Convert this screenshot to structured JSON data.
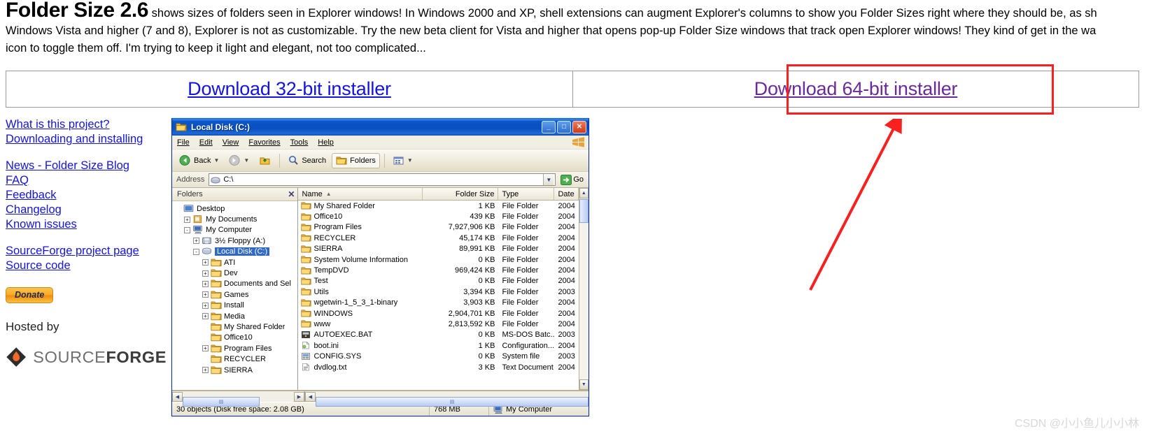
{
  "intro": {
    "title": "Folder Size 2.6",
    "line1_rest": " shows sizes of folders seen in Explorer windows! In Windows 2000 and XP, shell extensions can augment Explorer's columns to show you Folder Sizes right where they should be, as sh",
    "line2": "Windows Vista and higher (7 and 8), Explorer is not as customizable. Try the new beta client for Vista and higher that opens pop-up Folder Size windows that track open Explorer windows! They kind of get in the wa",
    "line3": "icon to toggle them off. I'm trying to keep it light and elegant, not too complicated..."
  },
  "downloads": {
    "x86_label": "Download 32-bit installer",
    "x64_label": "Download 64-bit installer",
    "annotation_color": "#fb2020"
  },
  "sidebar": {
    "group1": [
      {
        "label": "What is this project?"
      },
      {
        "label": "Downloading and installing"
      }
    ],
    "group2": [
      {
        "label": "News - Folder Size Blog"
      },
      {
        "label": "FAQ"
      },
      {
        "label": "Feedback"
      },
      {
        "label": "Changelog"
      },
      {
        "label": "Known issues"
      }
    ],
    "group3": [
      {
        "label": "SourceForge project page"
      },
      {
        "label": "Source code"
      }
    ],
    "donate_label": "Donate",
    "hosted_by": "Hosted by",
    "sf_logo_light": "SOURCE",
    "sf_logo_bold": "FORGE"
  },
  "explorer": {
    "title": "Local Disk (C:)",
    "window_buttons": {
      "minimize": "_",
      "maximize": "□",
      "close": "✕"
    },
    "menu": [
      "File",
      "Edit",
      "View",
      "Favorites",
      "Tools",
      "Help"
    ],
    "toolbar": {
      "back": "Back",
      "search": "Search",
      "folders": "Folders"
    },
    "address": {
      "label": "Address",
      "value": "C:\\",
      "go": "Go"
    },
    "folders_pane": {
      "header": "Folders",
      "close": "✕"
    },
    "tree": [
      {
        "indent": 0,
        "expander": "",
        "icon": "desktop-icon",
        "label": "Desktop",
        "selected": false
      },
      {
        "indent": 1,
        "expander": "+",
        "icon": "documents-icon",
        "label": "My Documents",
        "selected": false
      },
      {
        "indent": 1,
        "expander": "-",
        "icon": "computer-icon",
        "label": "My Computer",
        "selected": false
      },
      {
        "indent": 2,
        "expander": "+",
        "icon": "floppy-icon",
        "label": "3½ Floppy (A:)",
        "selected": false
      },
      {
        "indent": 2,
        "expander": "-",
        "icon": "drive-icon",
        "label": "Local Disk (C:)",
        "selected": true
      },
      {
        "indent": 3,
        "expander": "+",
        "icon": "folder-icon",
        "label": "ATI",
        "selected": false
      },
      {
        "indent": 3,
        "expander": "+",
        "icon": "folder-icon",
        "label": "Dev",
        "selected": false
      },
      {
        "indent": 3,
        "expander": "+",
        "icon": "folder-icon",
        "label": "Documents and Sel",
        "selected": false
      },
      {
        "indent": 3,
        "expander": "+",
        "icon": "folder-icon",
        "label": "Games",
        "selected": false
      },
      {
        "indent": 3,
        "expander": "+",
        "icon": "folder-icon",
        "label": "Install",
        "selected": false
      },
      {
        "indent": 3,
        "expander": "+",
        "icon": "folder-icon",
        "label": "Media",
        "selected": false
      },
      {
        "indent": 3,
        "expander": "",
        "icon": "folder-icon",
        "label": "My Shared Folder",
        "selected": false
      },
      {
        "indent": 3,
        "expander": "",
        "icon": "folder-icon",
        "label": "Office10",
        "selected": false
      },
      {
        "indent": 3,
        "expander": "+",
        "icon": "folder-icon",
        "label": "Program Files",
        "selected": false
      },
      {
        "indent": 3,
        "expander": "",
        "icon": "folder-icon",
        "label": "RECYCLER",
        "selected": false
      },
      {
        "indent": 3,
        "expander": "+",
        "icon": "folder-icon",
        "label": "SIERRA",
        "selected": false
      }
    ],
    "columns": {
      "name": "Name",
      "size": "Folder Size",
      "type": "Type",
      "date": "Date",
      "sort_arrow": "▲"
    },
    "files": [
      {
        "icon": "folder-icon",
        "name": "My Shared Folder",
        "size": "1 KB",
        "type": "File Folder",
        "date": "2004"
      },
      {
        "icon": "folder-icon",
        "name": "Office10",
        "size": "439 KB",
        "type": "File Folder",
        "date": "2004"
      },
      {
        "icon": "folder-icon",
        "name": "Program Files",
        "size": "7,927,906 KB",
        "type": "File Folder",
        "date": "2004"
      },
      {
        "icon": "folder-icon",
        "name": "RECYCLER",
        "size": "45,174 KB",
        "type": "File Folder",
        "date": "2004"
      },
      {
        "icon": "folder-icon",
        "name": "SIERRA",
        "size": "89,991 KB",
        "type": "File Folder",
        "date": "2004"
      },
      {
        "icon": "folder-icon",
        "name": "System Volume Information",
        "size": "0 KB",
        "type": "File Folder",
        "date": "2004"
      },
      {
        "icon": "folder-icon",
        "name": "TempDVD",
        "size": "969,424 KB",
        "type": "File Folder",
        "date": "2004"
      },
      {
        "icon": "folder-icon",
        "name": "Test",
        "size": "0 KB",
        "type": "File Folder",
        "date": "2004"
      },
      {
        "icon": "folder-icon",
        "name": "Utils",
        "size": "3,394 KB",
        "type": "File Folder",
        "date": "2003"
      },
      {
        "icon": "folder-icon",
        "name": "wgetwin-1_5_3_1-binary",
        "size": "3,903 KB",
        "type": "File Folder",
        "date": "2004"
      },
      {
        "icon": "folder-icon",
        "name": "WINDOWS",
        "size": "2,904,701 KB",
        "type": "File Folder",
        "date": "2004"
      },
      {
        "icon": "folder-icon",
        "name": "www",
        "size": "2,813,592 KB",
        "type": "File Folder",
        "date": "2004"
      },
      {
        "icon": "batch-icon",
        "name": "AUTOEXEC.BAT",
        "size": "0 KB",
        "type": "MS-DOS Batc...",
        "date": "2003"
      },
      {
        "icon": "config-icon",
        "name": "boot.ini",
        "size": "1 KB",
        "type": "Configuration...",
        "date": "2004"
      },
      {
        "icon": "sysfile-icon",
        "name": "CONFIG.SYS",
        "size": "0 KB",
        "type": "System file",
        "date": "2003"
      },
      {
        "icon": "text-icon",
        "name": "dvdlog.txt",
        "size": "3 KB",
        "type": "Text Document",
        "date": "2004"
      }
    ],
    "status": {
      "objects": "30 objects (Disk free space: 2.08 GB)",
      "size": "768 MB",
      "location": "My Computer"
    }
  },
  "watermark": "CSDN @小小鱼儿小小林"
}
